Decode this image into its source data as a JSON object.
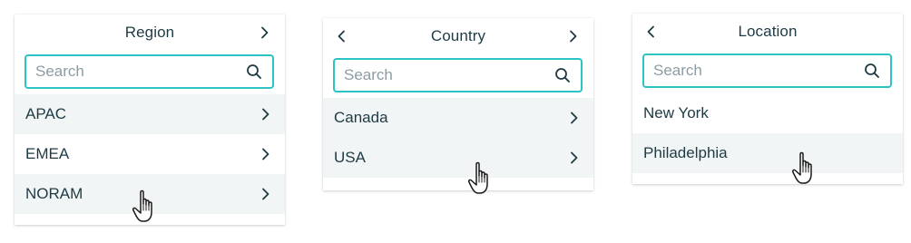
{
  "panels": {
    "region": {
      "title": "Region",
      "search_placeholder": "Search",
      "items": [
        {
          "label": "APAC"
        },
        {
          "label": "EMEA"
        },
        {
          "label": "NORAM"
        }
      ]
    },
    "country": {
      "title": "Country",
      "search_placeholder": "Search",
      "items": [
        {
          "label": "Canada"
        },
        {
          "label": "USA"
        }
      ]
    },
    "location": {
      "title": "Location",
      "search_placeholder": "Search",
      "items": [
        {
          "label": "New York"
        },
        {
          "label": "Philadelphia"
        }
      ]
    }
  },
  "icons": {
    "back": "chevron-left-icon",
    "forward": "chevron-right-icon",
    "search": "search-icon",
    "cursor": "hand-pointer-icon"
  },
  "colors": {
    "accent": "#2bc3c6",
    "text": "#1e3a44",
    "placeholder": "#8c9ca3",
    "row_shade": "#f2f5f5"
  }
}
